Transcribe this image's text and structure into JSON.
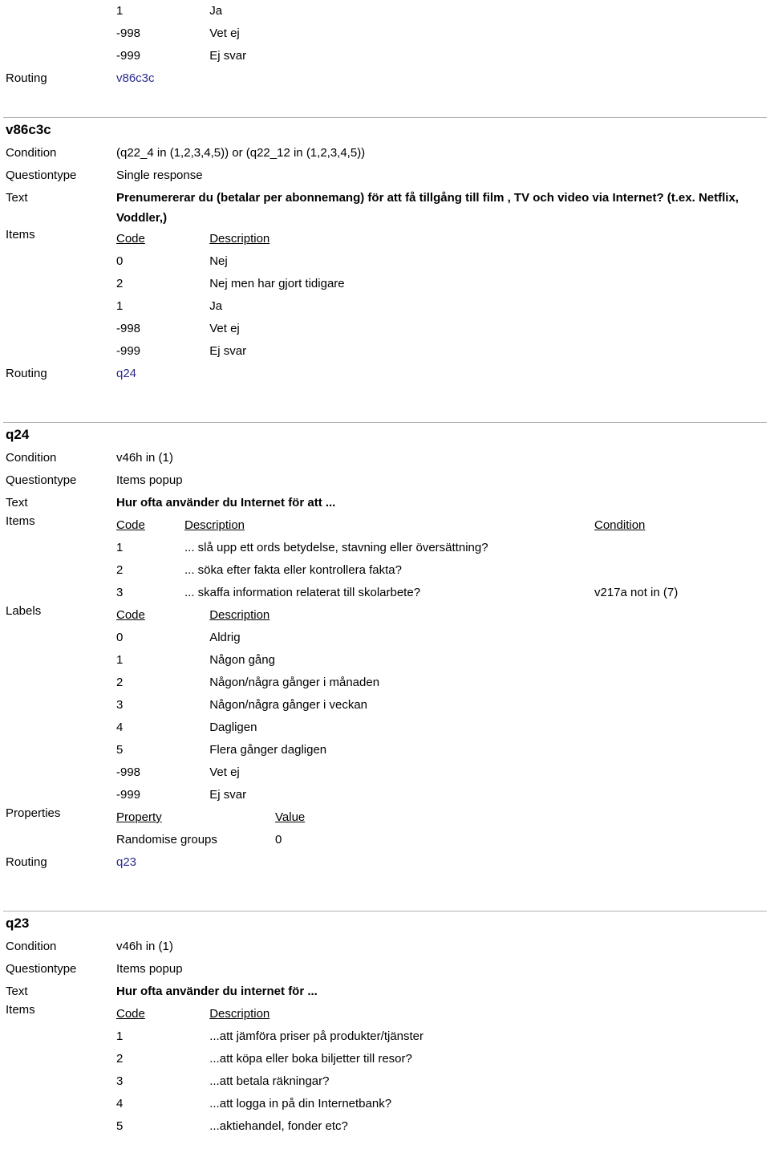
{
  "labels": {
    "condition": "Condition",
    "questiontype": "Questiontype",
    "text": "Text",
    "items": "Items",
    "labels": "Labels",
    "properties": "Properties",
    "routing": "Routing"
  },
  "table_headers": {
    "code": "Code",
    "description": "Description",
    "condition": "Condition",
    "property": "Property",
    "value": "Value"
  },
  "carryover": {
    "items": [
      {
        "code": "1",
        "description": "Ja"
      },
      {
        "code": "-998",
        "description": "Vet ej"
      },
      {
        "code": "-999",
        "description": "Ej svar"
      }
    ],
    "routing": "v86c3c"
  },
  "sections": [
    {
      "id": "v86c3c",
      "title": "v86c3c",
      "condition": "(q22_4 in (1,2,3,4,5)) or (q22_12 in (1,2,3,4,5))",
      "questiontype": "Single response",
      "text": "Prenumererar du (betalar per abonnemang) för att få tillgång till film , TV och video via Internet? (t.ex. Netflix, Voddler,)",
      "items": [
        {
          "code": "0",
          "description": "Nej"
        },
        {
          "code": "2",
          "description": "Nej men har gjort tidigare"
        },
        {
          "code": "1",
          "description": "Ja"
        },
        {
          "code": "-998",
          "description": "Vet ej"
        },
        {
          "code": "-999",
          "description": "Ej svar"
        }
      ],
      "routing": "q24"
    },
    {
      "id": "q24",
      "title": "q24",
      "condition": "v46h in (1)",
      "questiontype": "Items popup",
      "text": "Hur ofta använder du Internet för att ...",
      "items": [
        {
          "code": "1",
          "description": "... slå upp ett ords betydelse, stavning eller översättning?",
          "condition": ""
        },
        {
          "code": "2",
          "description": "... söka efter fakta eller kontrollera fakta?",
          "condition": ""
        },
        {
          "code": "3",
          "description": "... skaffa information relaterat till skolarbete?",
          "condition": "v217a not in (7)"
        }
      ],
      "label_items": [
        {
          "code": "0",
          "description": "Aldrig"
        },
        {
          "code": "1",
          "description": "Någon gång"
        },
        {
          "code": "2",
          "description": "Någon/några gånger i månaden"
        },
        {
          "code": "3",
          "description": "Någon/några gånger i veckan"
        },
        {
          "code": "4",
          "description": "Dagligen"
        },
        {
          "code": "5",
          "description": "Flera gånger dagligen"
        },
        {
          "code": "-998",
          "description": "Vet ej"
        },
        {
          "code": "-999",
          "description": "Ej svar"
        }
      ],
      "properties": [
        {
          "property": "Randomise groups",
          "value": "0"
        }
      ],
      "routing": "q23"
    },
    {
      "id": "q23",
      "title": "q23",
      "condition": "v46h in (1)",
      "questiontype": "Items popup",
      "text": "Hur ofta använder du internet för ...",
      "items": [
        {
          "code": "1",
          "description": "...att jämföra priser på produkter/tjänster"
        },
        {
          "code": "2",
          "description": "...att köpa eller boka biljetter till resor?"
        },
        {
          "code": "3",
          "description": "...att betala räkningar?"
        },
        {
          "code": "4",
          "description": "...att logga in på din Internetbank?"
        },
        {
          "code": "5",
          "description": "...aktiehandel, fonder etc?"
        }
      ]
    }
  ],
  "colors": {
    "link": "#2b2b8f",
    "separator": "#b0b0b0",
    "text": "#000000"
  }
}
